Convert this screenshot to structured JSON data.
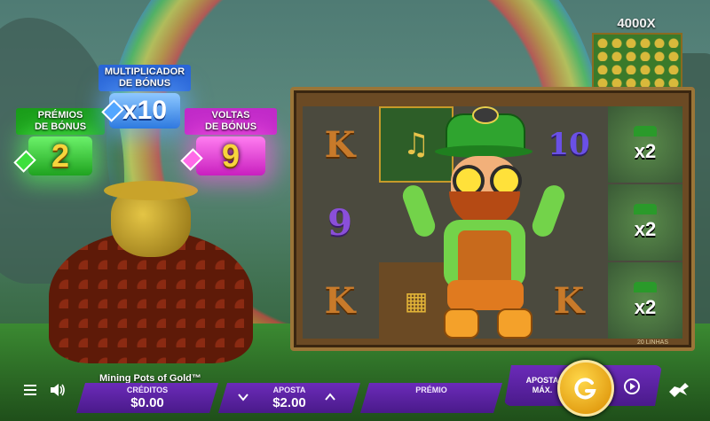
{
  "game": {
    "title": "Mining Pots of Gold™"
  },
  "bonus": {
    "prizes": {
      "title_line1": "PRÉMIOS",
      "title_line2": "DE BÓNUS",
      "value": "2"
    },
    "multiplier": {
      "title_line1": "MULTIPLICADOR",
      "title_line2": "DE BÓNUS",
      "value": "x10"
    },
    "spins": {
      "title_line1": "VOLTAS",
      "title_line2": "DE BÓNUS",
      "value": "9"
    }
  },
  "jackpot": {
    "label": "4000X"
  },
  "reels": {
    "lines_label": "20 LINHAS",
    "symbols": [
      [
        "K",
        "harp",
        "leprechaun",
        "10",
        "x2"
      ],
      [
        "9",
        "",
        "leprechaun",
        "",
        "x2"
      ],
      [
        "K",
        "chest",
        "leprechaun",
        "K",
        "x2"
      ]
    ],
    "multiplier_label": "x2"
  },
  "bottom_bar": {
    "credits": {
      "label": "CRÉDITOS",
      "value": "$0.00"
    },
    "bet": {
      "label": "APOSTA",
      "value": "$2.00"
    },
    "prize": {
      "label": "PRÉMIO",
      "value": ""
    },
    "max_bet": {
      "line1": "APOSTA",
      "line2": "MÁX."
    }
  },
  "icons": {
    "menu": "menu-icon",
    "sound": "speaker-icon",
    "spin": "spin-icon",
    "autoplay": "autoplay-icon",
    "brand": "brand-logo-icon",
    "bet_down": "chevron-down-icon",
    "bet_up": "chevron-up-icon"
  },
  "colors": {
    "panel_purple": "#5a22a0",
    "spin_gold": "#f2b41c",
    "green_box": "#2fd12f",
    "blue_box": "#3a8bf0",
    "pink_box": "#e03ad6"
  }
}
